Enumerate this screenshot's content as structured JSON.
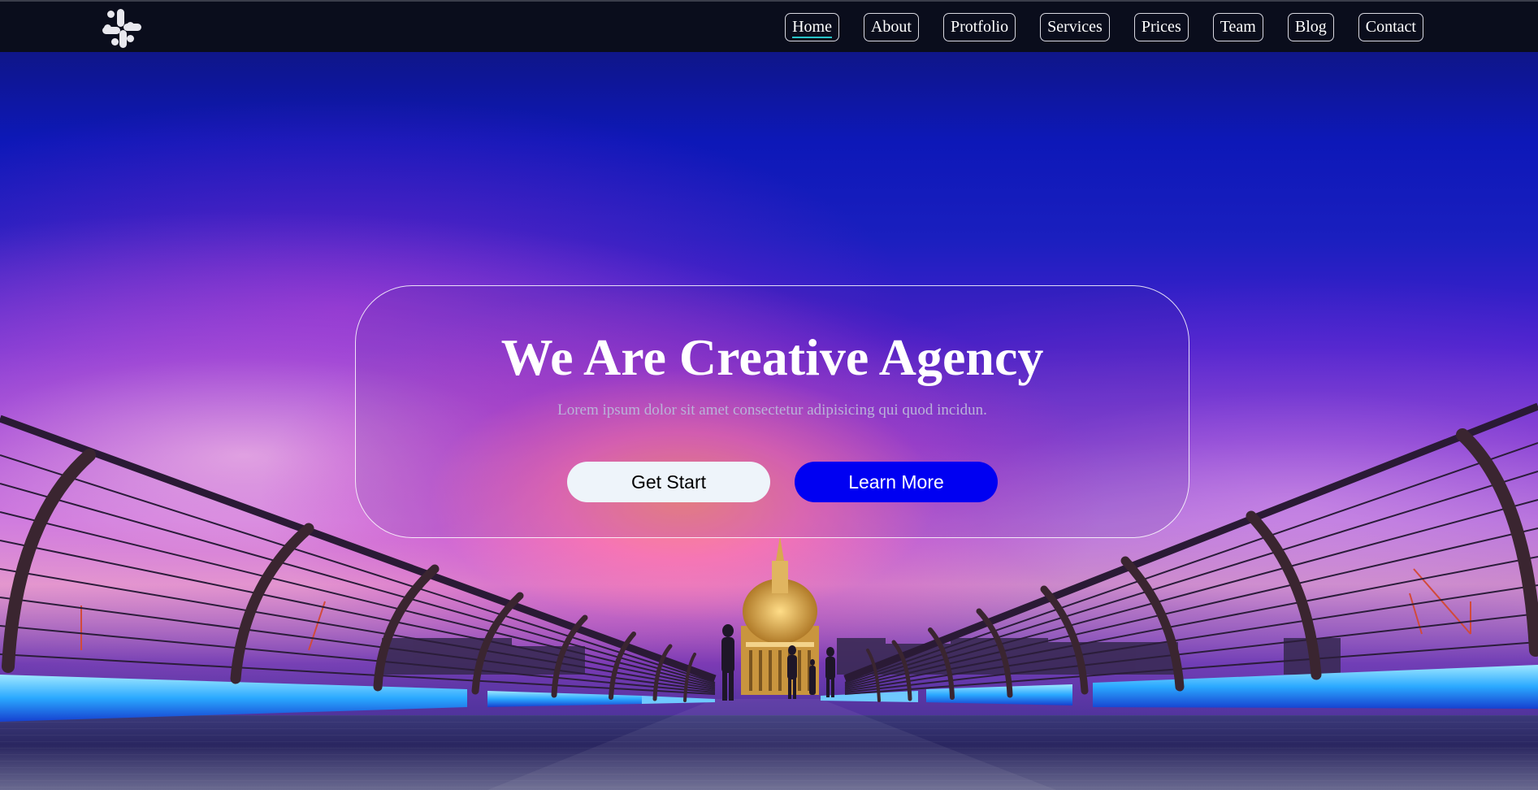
{
  "nav": {
    "logo_icon": "slack-logo-icon",
    "items": [
      {
        "label": "Home",
        "active": true
      },
      {
        "label": "About",
        "active": false
      },
      {
        "label": "Protfolio",
        "active": false
      },
      {
        "label": "Services",
        "active": false
      },
      {
        "label": "Prices",
        "active": false
      },
      {
        "label": "Team",
        "active": false
      },
      {
        "label": "Blog",
        "active": false
      },
      {
        "label": "Contact",
        "active": false
      }
    ],
    "active_underline_color": "#28c4c8"
  },
  "hero": {
    "background_image": "city-bridge-sunset-photo",
    "title": "We Are Creative Agency",
    "subtitle": "Lorem ipsum dolor sit amet consectetur adipisicing qui quod incidun.",
    "buttons": {
      "get_start": "Get Start",
      "learn_more": "Learn More"
    },
    "colors": {
      "learn_more_bg": "#0000f2",
      "get_start_bg": "#eef4fa"
    }
  }
}
